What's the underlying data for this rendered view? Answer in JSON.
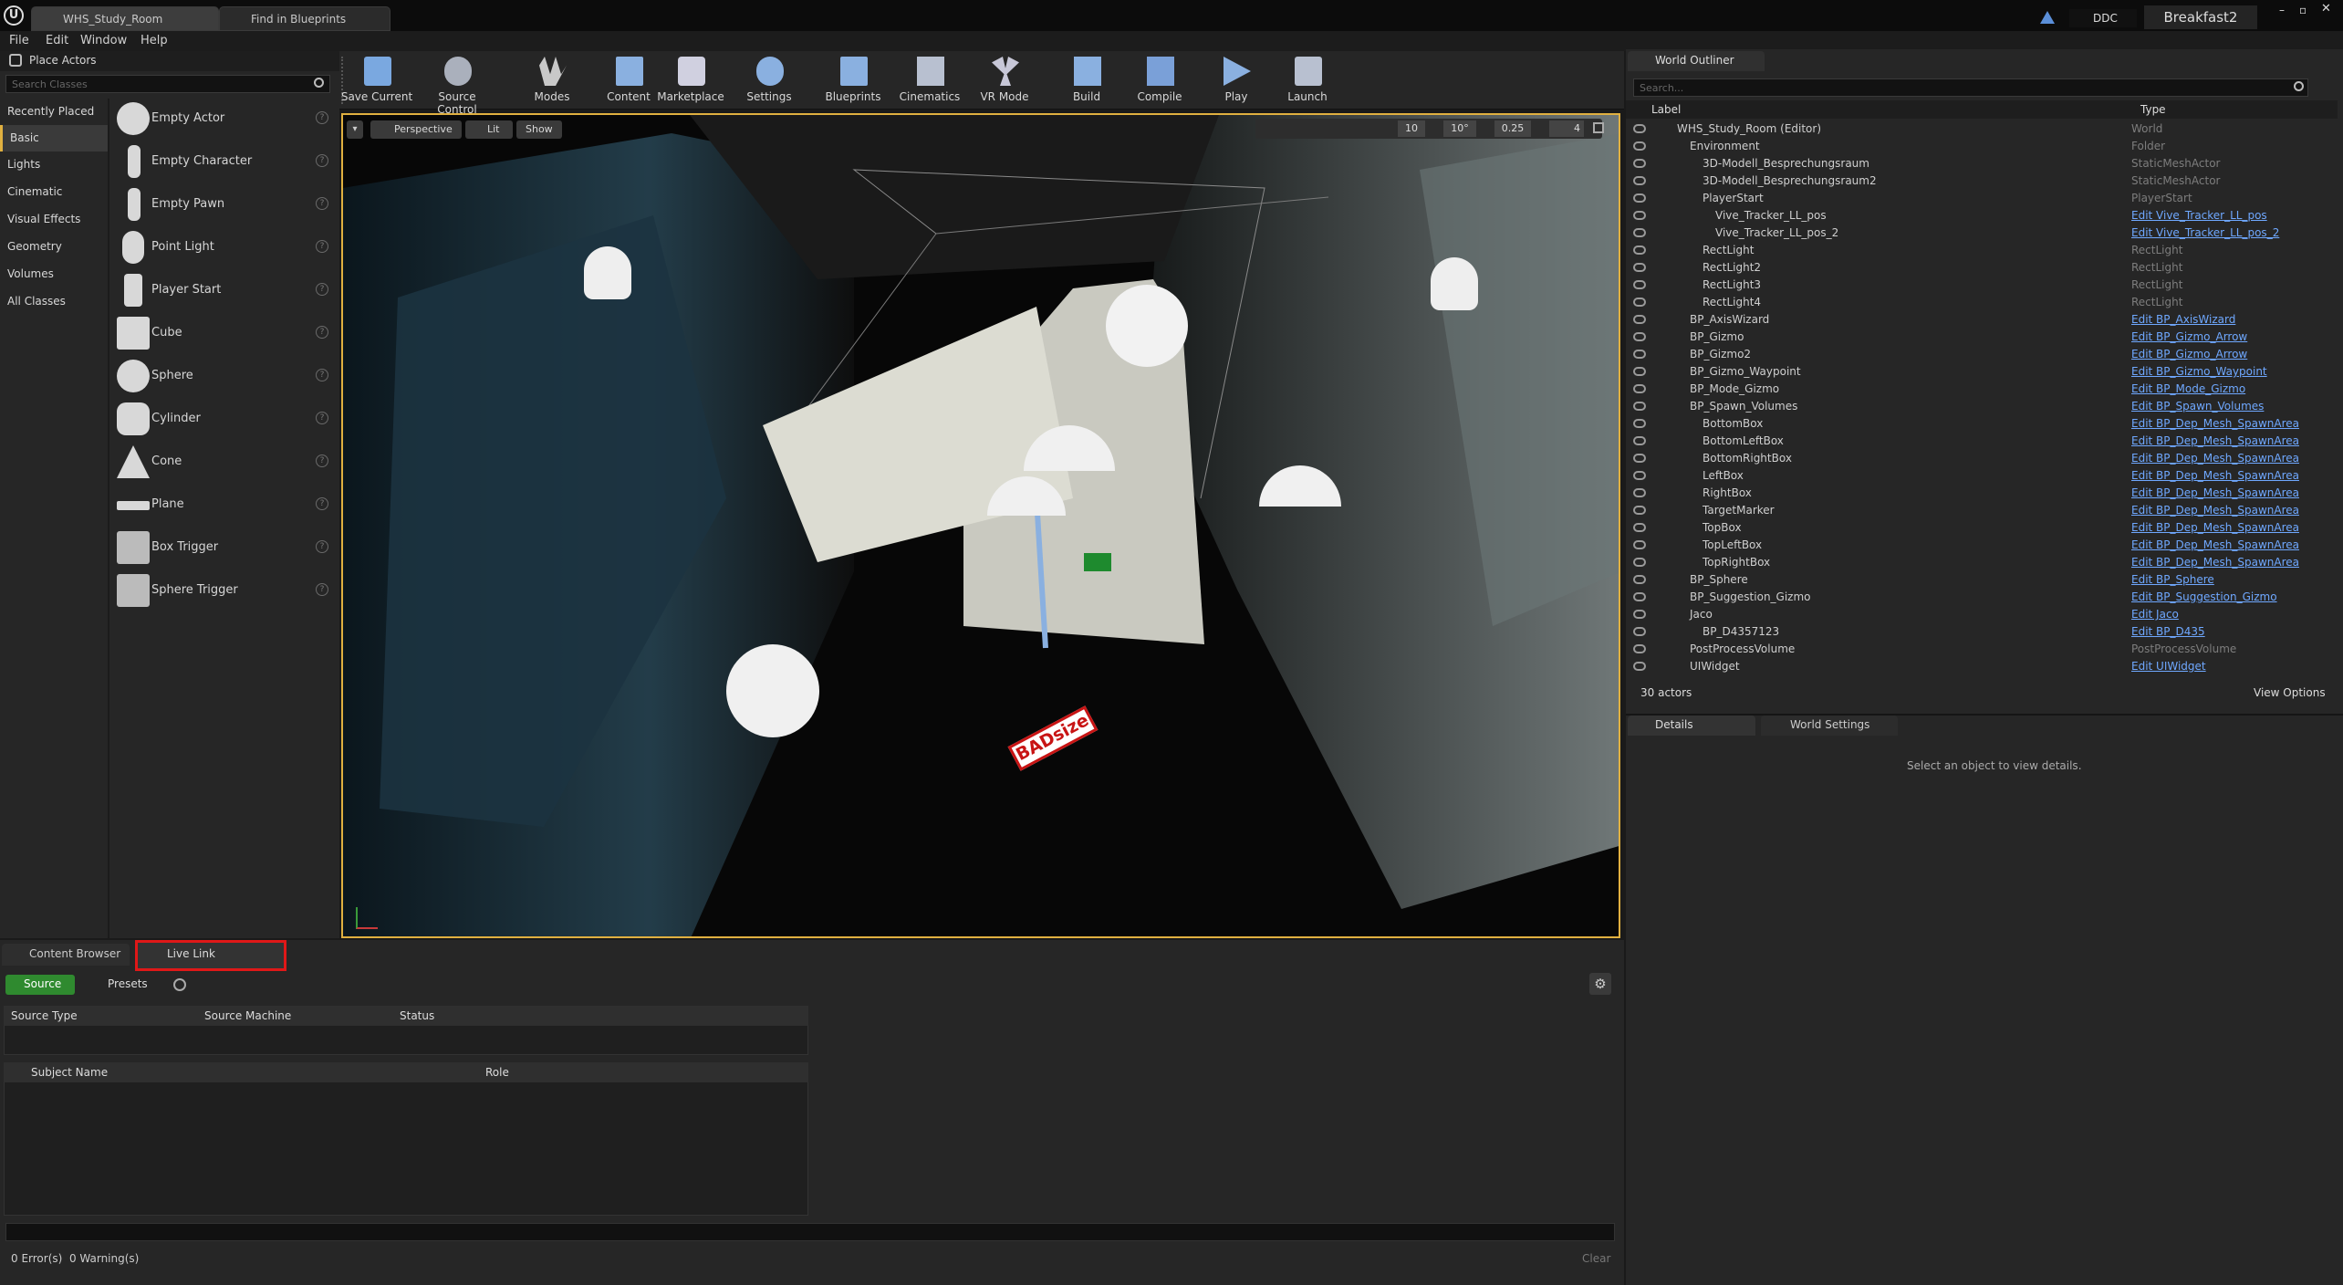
{
  "window": {
    "tabs": [
      "WHS_Study_Room",
      "Find in Blueprints"
    ],
    "project": "Breakfast2",
    "ddc": "DDC"
  },
  "menu": [
    "File",
    "Edit",
    "Window",
    "Help"
  ],
  "place_actors": {
    "title": "Place Actors",
    "search_placeholder": "Search Classes",
    "categories": [
      "Recently Placed",
      "Basic",
      "Lights",
      "Cinematic",
      "Visual Effects",
      "Geometry",
      "Volumes",
      "All Classes"
    ],
    "items": [
      "Empty Actor",
      "Empty Character",
      "Empty Pawn",
      "Point Light",
      "Player Start",
      "Cube",
      "Sphere",
      "Cylinder",
      "Cone",
      "Plane",
      "Box Trigger",
      "Sphere Trigger"
    ]
  },
  "toolbar": [
    "Save Current",
    "Source Control",
    "Modes",
    "Content",
    "Marketplace",
    "Settings",
    "Blueprints",
    "Cinematics",
    "VR Mode",
    "Build",
    "Compile",
    "Play",
    "Launch"
  ],
  "viewport": {
    "perspective": "Perspective",
    "lit": "Lit",
    "show": "Show",
    "snap_grid": "10",
    "snap_rot": "10°",
    "snap_scale": "0.25",
    "cam_speed": "4",
    "sign_text": "BADsize"
  },
  "outliner": {
    "title": "World Outliner",
    "search_placeholder": "Search...",
    "col_label": "Label",
    "col_type": "Type",
    "rows": [
      {
        "label": "WHS_Study_Room (Editor)",
        "type": "World",
        "indent": 0,
        "link": false
      },
      {
        "label": "Environment",
        "type": "Folder",
        "indent": 1,
        "link": false
      },
      {
        "label": "3D-Modell_Besprechungsraum",
        "type": "StaticMeshActor",
        "indent": 2,
        "link": false
      },
      {
        "label": "3D-Modell_Besprechungsraum2",
        "type": "StaticMeshActor",
        "indent": 2,
        "link": false
      },
      {
        "label": "PlayerStart",
        "type": "PlayerStart",
        "indent": 2,
        "link": false
      },
      {
        "label": "Vive_Tracker_LL_pos",
        "type": "Edit Vive_Tracker_LL_pos",
        "indent": 3,
        "link": true
      },
      {
        "label": "Vive_Tracker_LL_pos_2",
        "type": "Edit Vive_Tracker_LL_pos_2",
        "indent": 3,
        "link": true
      },
      {
        "label": "RectLight",
        "type": "RectLight",
        "indent": 2,
        "link": false
      },
      {
        "label": "RectLight2",
        "type": "RectLight",
        "indent": 2,
        "link": false
      },
      {
        "label": "RectLight3",
        "type": "RectLight",
        "indent": 2,
        "link": false
      },
      {
        "label": "RectLight4",
        "type": "RectLight",
        "indent": 2,
        "link": false
      },
      {
        "label": "BP_AxisWizard",
        "type": "Edit BP_AxisWizard",
        "indent": 1,
        "link": true
      },
      {
        "label": "BP_Gizmo",
        "type": "Edit BP_Gizmo_Arrow",
        "indent": 1,
        "link": true
      },
      {
        "label": "BP_Gizmo2",
        "type": "Edit BP_Gizmo_Arrow",
        "indent": 1,
        "link": true
      },
      {
        "label": "BP_Gizmo_Waypoint",
        "type": "Edit BP_Gizmo_Waypoint",
        "indent": 1,
        "link": true
      },
      {
        "label": "BP_Mode_Gizmo",
        "type": "Edit BP_Mode_Gizmo",
        "indent": 1,
        "link": true
      },
      {
        "label": "BP_Spawn_Volumes",
        "type": "Edit BP_Spawn_Volumes",
        "indent": 1,
        "link": true
      },
      {
        "label": "BottomBox",
        "type": "Edit BP_Dep_Mesh_SpawnArea",
        "indent": 2,
        "link": true
      },
      {
        "label": "BottomLeftBox",
        "type": "Edit BP_Dep_Mesh_SpawnArea",
        "indent": 2,
        "link": true
      },
      {
        "label": "BottomRightBox",
        "type": "Edit BP_Dep_Mesh_SpawnArea",
        "indent": 2,
        "link": true
      },
      {
        "label": "LeftBox",
        "type": "Edit BP_Dep_Mesh_SpawnArea",
        "indent": 2,
        "link": true
      },
      {
        "label": "RightBox",
        "type": "Edit BP_Dep_Mesh_SpawnArea",
        "indent": 2,
        "link": true
      },
      {
        "label": "TargetMarker",
        "type": "Edit BP_Dep_Mesh_SpawnArea",
        "indent": 2,
        "link": true
      },
      {
        "label": "TopBox",
        "type": "Edit BP_Dep_Mesh_SpawnArea",
        "indent": 2,
        "link": true
      },
      {
        "label": "TopLeftBox",
        "type": "Edit BP_Dep_Mesh_SpawnArea",
        "indent": 2,
        "link": true
      },
      {
        "label": "TopRightBox",
        "type": "Edit BP_Dep_Mesh_SpawnArea",
        "indent": 2,
        "link": true
      },
      {
        "label": "BP_Sphere",
        "type": "Edit BP_Sphere",
        "indent": 1,
        "link": true
      },
      {
        "label": "BP_Suggestion_Gizmo",
        "type": "Edit BP_Suggestion_Gizmo",
        "indent": 1,
        "link": true
      },
      {
        "label": "Jaco",
        "type": "Edit Jaco",
        "indent": 1,
        "link": true
      },
      {
        "label": "BP_D4357123",
        "type": "Edit BP_D435",
        "indent": 2,
        "link": true
      },
      {
        "label": "PostProcessVolume",
        "type": "PostProcessVolume",
        "indent": 1,
        "link": false
      },
      {
        "label": "UIWidget",
        "type": "Edit UIWidget",
        "indent": 1,
        "link": true
      }
    ],
    "count": "30 actors",
    "view_options": "View Options"
  },
  "details": {
    "tab1": "Details",
    "tab2": "World Settings",
    "empty": "Select an object to view details."
  },
  "bottom": {
    "tab1": "Content Browser",
    "tab2": "Live Link",
    "source_btn": "Source",
    "presets_btn": "Presets",
    "cols1": [
      "Source Type",
      "Source Machine",
      "Status"
    ],
    "cols2": [
      "Subject Name",
      "Role"
    ],
    "status": "0 Error(s)  0 Warning(s)",
    "clear": "Clear"
  }
}
